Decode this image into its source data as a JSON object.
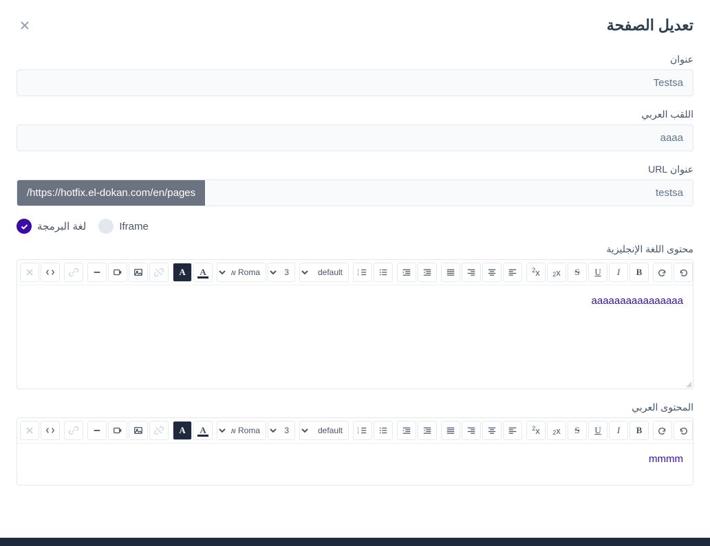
{
  "header": {
    "title": "تعديل الصفحة"
  },
  "fields": {
    "title_label": "عنوان",
    "title_value": "Testsa",
    "arabic_title_label": "اللقب العربي",
    "arabic_title_value": "aaaa",
    "url_label": "عنوان URL",
    "url_value": "testsa",
    "url_prefix": "/https://hotfix.el-dokan.com/en/pages"
  },
  "mode": {
    "iframe_label": "Iframe",
    "code_label": "لغة البرمجة",
    "selected": "code"
  },
  "editors": {
    "en_label": "محتوى اللغة الإنجليزية",
    "en_content": "aaaaaaaaaaaaaaaa",
    "ar_label": "المحتوى العربي",
    "ar_content": "mmmm"
  },
  "toolbar": {
    "font_family": "es New Roma",
    "font_size": "3",
    "style_default": "default"
  }
}
